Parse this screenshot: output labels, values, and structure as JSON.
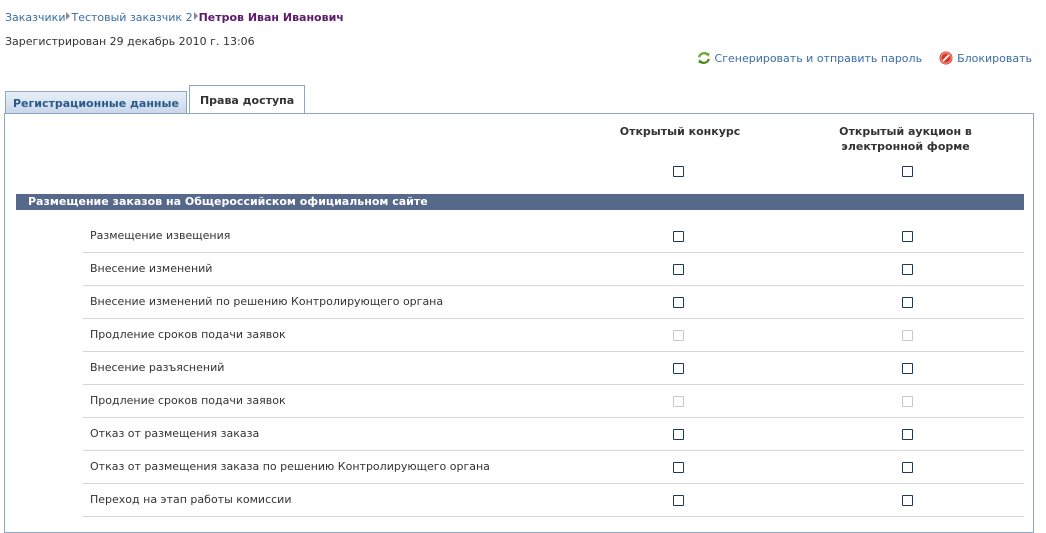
{
  "breadcrumb": {
    "items": [
      "Заказчики",
      "Тестовый заказчик 2"
    ],
    "current": "Петров Иван Иванович"
  },
  "registered_text": "Зарегистрирован 29 декабрь 2010 г. 13:06",
  "actions": {
    "generate_password": "Сгенерировать и отправить пароль",
    "block": "Блокировать"
  },
  "tabs": [
    {
      "label": "Регистрационные данные",
      "active": false
    },
    {
      "label": "Права доступа",
      "active": true
    }
  ],
  "columns": [
    "Открытый конкурс",
    "Открытый аукцион в электронной форме"
  ],
  "section": {
    "title": "Размещение заказов на Общероссийском официальном сайте"
  },
  "rows": [
    {
      "label": "Размещение извещения",
      "enabled": true
    },
    {
      "label": "Внесение изменений",
      "enabled": true
    },
    {
      "label": "Внесение изменений по решению Контролирующего органа",
      "enabled": true
    },
    {
      "label": "Продление сроков подачи заявок",
      "enabled": false
    },
    {
      "label": "Внесение разъяснений",
      "enabled": true
    },
    {
      "label": "Продление сроков подачи заявок",
      "enabled": false
    },
    {
      "label": "Отказ от размещения заказа",
      "enabled": true
    },
    {
      "label": "Отказ от размещения заказа по решению Контролирующего органа",
      "enabled": true
    },
    {
      "label": "Переход на этап работы комиссии",
      "enabled": true
    }
  ],
  "icons": {
    "generate": "refresh-icon",
    "block": "block-icon"
  },
  "colors": {
    "link": "#3a6ea5",
    "current": "#5c1a6b",
    "section_bar": "#56698a",
    "tab_border": "#8ea6c6"
  }
}
